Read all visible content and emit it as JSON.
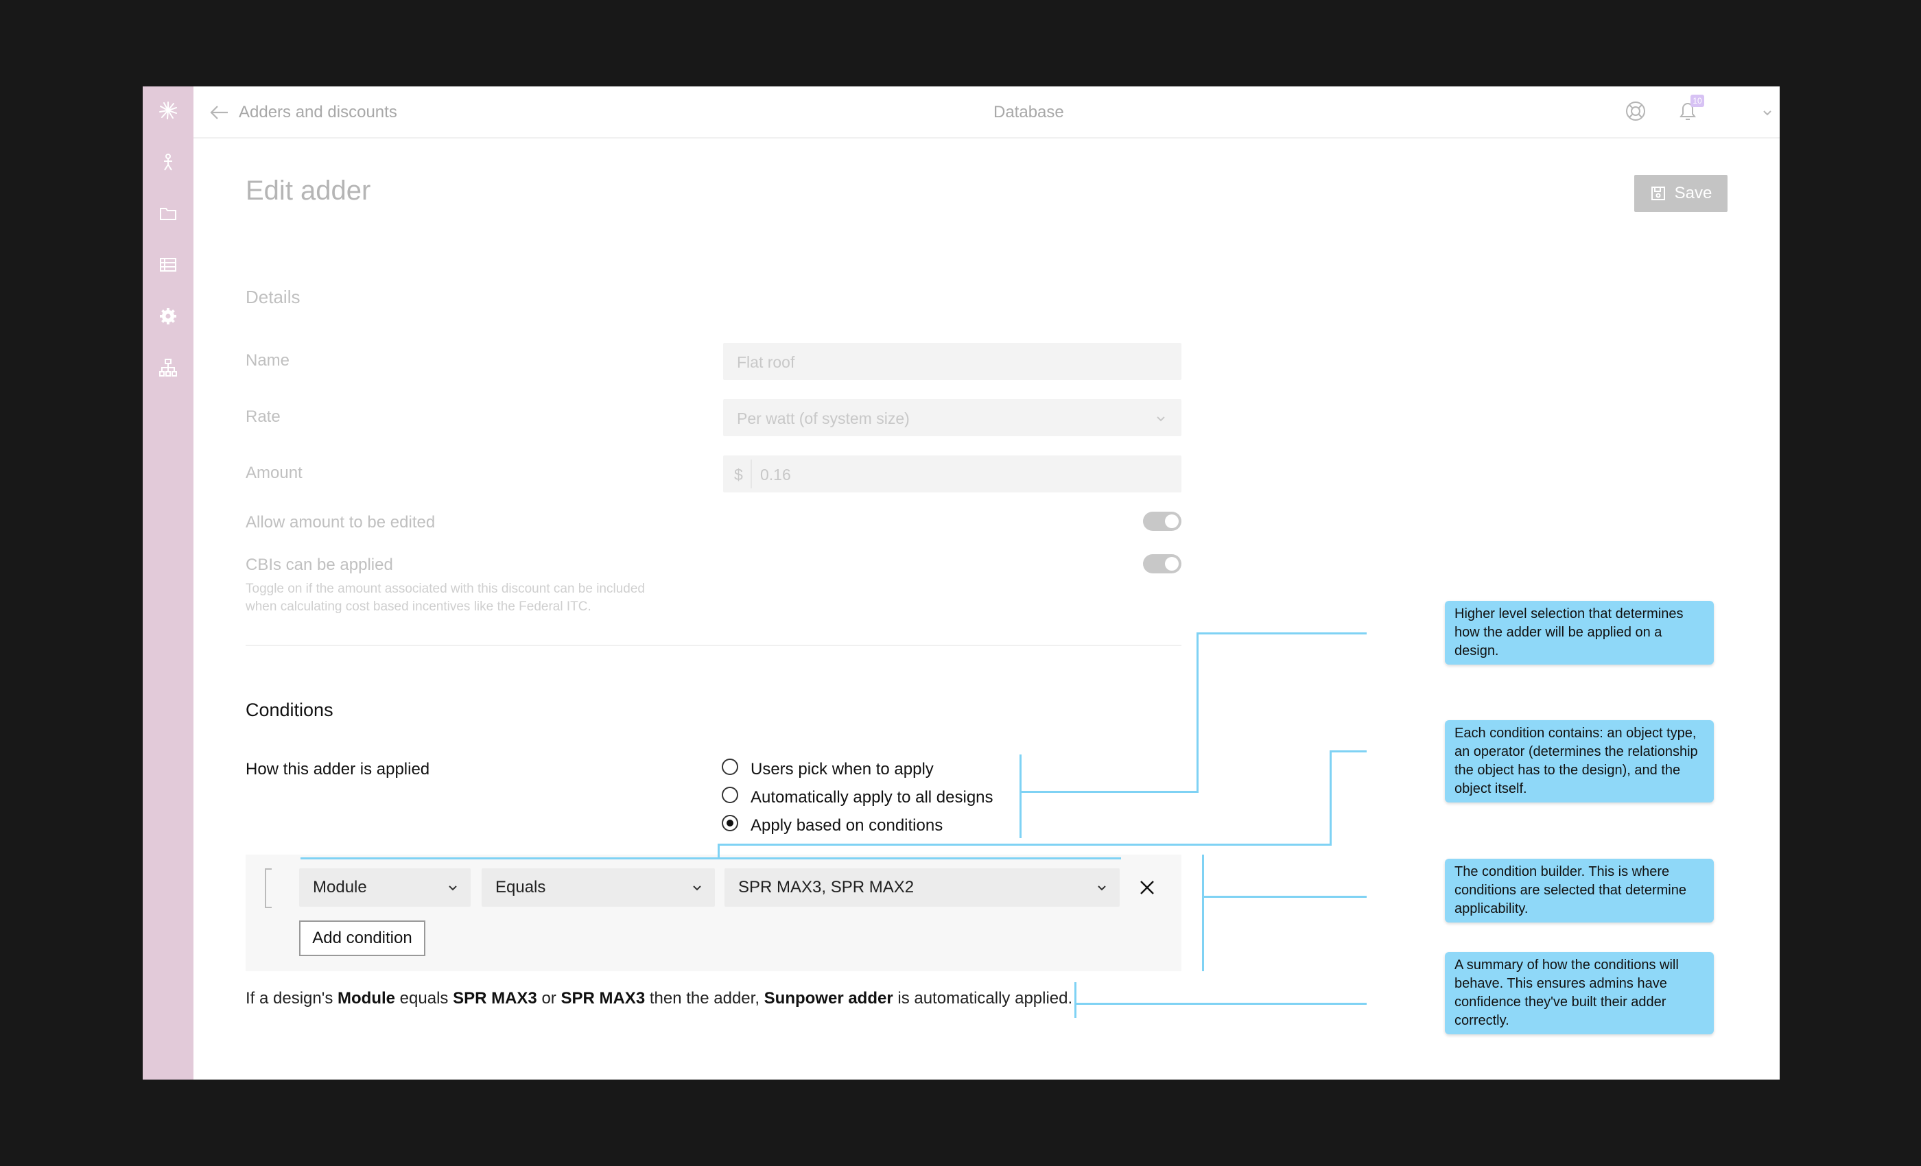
{
  "topbar": {
    "back_label": "Adders and discounts",
    "center_title": "Database",
    "notification_count": "10"
  },
  "page": {
    "title": "Edit adder",
    "save_label": "Save"
  },
  "details": {
    "heading": "Details",
    "name_label": "Name",
    "name_value": "Flat roof",
    "rate_label": "Rate",
    "rate_value": "Per watt (of system size)",
    "amount_label": "Amount",
    "amount_prefix": "$",
    "amount_value": "0.16",
    "allow_edit_label": "Allow amount to be edited",
    "allow_edit_on": true,
    "cbi_label": "CBIs can be applied",
    "cbi_on": true,
    "cbi_help_line1": "Toggle on if the amount associated with this discount can be included",
    "cbi_help_line2": "when calculating cost based incentives like the Federal ITC."
  },
  "conditions": {
    "heading": "Conditions",
    "apply_label": "How this adder is applied",
    "options": [
      {
        "label": "Users pick when to apply",
        "selected": false
      },
      {
        "label": "Automatically apply to all designs",
        "selected": false
      },
      {
        "label": "Apply based on conditions",
        "selected": true
      }
    ],
    "builder": {
      "object_type": "Module",
      "operator": "Equals",
      "object_value": "SPR MAX3, SPR MAX2",
      "add_label": "Add condition"
    },
    "summary": {
      "p1": "If a design's",
      "b1": "Module",
      "p2": "equals",
      "b2": "SPR MAX3",
      "p3": "or",
      "b3": "SPR MAX3",
      "p4": "then the adder,",
      "b4": "Sunpower adder",
      "p5": "is automatically applied."
    }
  },
  "callouts": [
    "Higher level selection that determines how the adder will be applied on a design.",
    "Each condition contains: an object type, an operator (determines the relationship the object has to the design), and the object itself.",
    "The condition builder. This is where conditions are selected that determine applicability.",
    "A summary of how the conditions will behave. This ensures admins have confidence they've built their adder correctly."
  ],
  "colors": {
    "sidebar": "#e2cad9",
    "callout": "#8fd8f8",
    "connector": "#7fd2f4",
    "save_button": "#c4c4c4"
  }
}
